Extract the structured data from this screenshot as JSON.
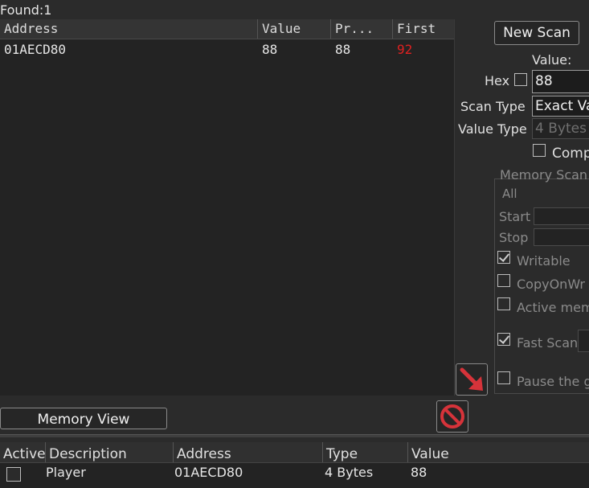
{
  "found_label": "Found:1",
  "results": {
    "columns": [
      "Address",
      "Value",
      "Pr...",
      "First"
    ],
    "rows": [
      {
        "address": "01AECD80",
        "value": "88",
        "previous": "88",
        "first": "92"
      }
    ]
  },
  "scan": {
    "new_scan_label": "New Scan",
    "value_label": "Value:",
    "hex_label": "Hex",
    "value_input": "88",
    "scan_type_label": "Scan Type",
    "scan_type_value": "Exact Va",
    "value_type_label": "Value Type",
    "value_type_value": "4 Bytes",
    "compare_label": "Comp"
  },
  "memory_scan": {
    "group_label": "Memory Scan",
    "region_value": "All",
    "start_label": "Start",
    "stop_label": "Stop",
    "writable_label": "Writable",
    "copyonwrite_label": "CopyOnWr",
    "active_mem_label": "Active mem",
    "fast_scan_label": "Fast Scan",
    "pause_label": "Pause the g"
  },
  "memory_view_label": "Memory View",
  "address_list": {
    "columns": [
      "Active",
      "Description",
      "Address",
      "Type",
      "Value"
    ],
    "rows": [
      {
        "description": "Player",
        "address": "01AECD80",
        "type": "4 Bytes",
        "value": "88"
      }
    ]
  },
  "colors": {
    "changed_value": "#e02020",
    "arrow": "#d6333a",
    "stop_icon": "#d6333a"
  }
}
